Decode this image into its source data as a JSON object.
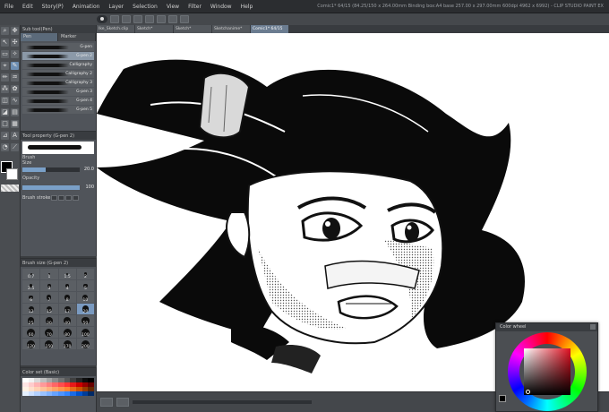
{
  "menu": [
    "File",
    "Edit",
    "Story(P)",
    "Animation",
    "Layer",
    "Selection",
    "View",
    "Filter",
    "Window",
    "Help"
  ],
  "window_title": "Comic1* 64/15 (84.25/150 x 264.00mm Binding box:A4 base 257.00 x 297.00mm 600dpi 4962 x 6992) - CLIP STUDIO PAINT EX",
  "doc_tabs": [
    "Ike_Sketch.clip",
    "Sketch*",
    "Sketch*",
    "Sketchanime*",
    "Comic1* 64/15"
  ],
  "subtool": {
    "header": "Sub tool(Pen)",
    "tabs": [
      "Pen",
      "Marker"
    ],
    "brushes": [
      "G-pen",
      "G-pen 2",
      "Calligraphy",
      "Calligraphy 2",
      "Calligraphy 3",
      "G-pen 3",
      "G-pen 4",
      "G-pen 5"
    ]
  },
  "toolprop": {
    "header": "Tool property (G-pen 2)",
    "brush_size_label": "Brush Size",
    "brush_size_value": "20.0",
    "opacity_label": "Opacity",
    "opacity_value": "100",
    "brush_size_fill": 0.4,
    "opacity_fill": 1.0,
    "brush_stroke_label": "Brush stroke"
  },
  "brushsize": {
    "header": "Brush size (G-pen 2)",
    "sizes": [
      "0.7",
      "1",
      "1.5",
      "2",
      "2.5",
      "3",
      "4",
      "5",
      "6",
      "7",
      "8",
      "10",
      "12",
      "15",
      "17",
      "20",
      "25",
      "30",
      "40",
      "50",
      "60",
      "70",
      "80",
      "100",
      "120",
      "150",
      "170",
      "200"
    ]
  },
  "colorset": {
    "header": "Color set (Basic)"
  },
  "colorwheel": {
    "header": "Color wheel"
  }
}
